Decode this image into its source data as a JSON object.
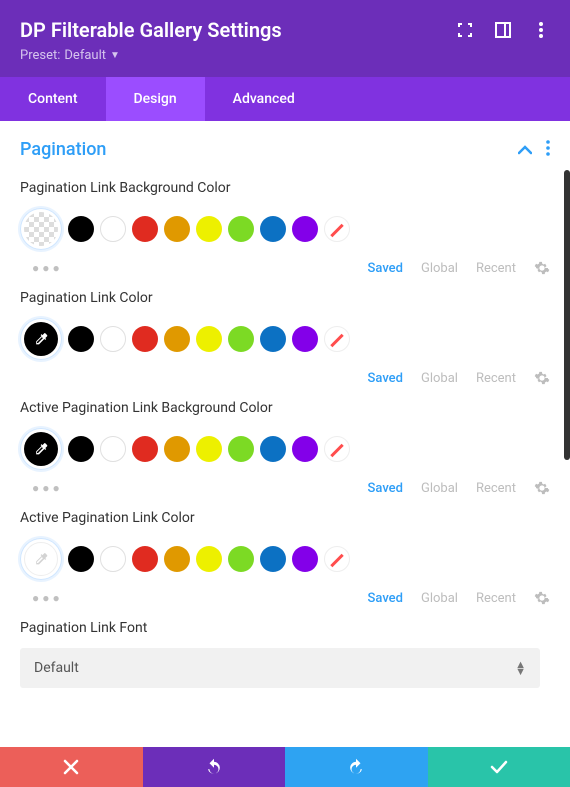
{
  "header": {
    "title": "DP Filterable Gallery Settings",
    "preset_label": "Preset:",
    "preset_value": "Default"
  },
  "tabs": {
    "content": "Content",
    "design": "Design",
    "advanced": "Advanced",
    "active": "design"
  },
  "section": {
    "title": "Pagination"
  },
  "footer_labels": {
    "saved": "Saved",
    "global": "Global",
    "recent": "Recent"
  },
  "fields": [
    {
      "label": "Pagination Link Background Color",
      "current": "transparent"
    },
    {
      "label": "Pagination Link Color",
      "current": "black"
    },
    {
      "label": "Active Pagination Link Background Color",
      "current": "black"
    },
    {
      "label": "Active Pagination Link Color",
      "current": "white"
    }
  ],
  "font_field": {
    "label": "Pagination Link Font",
    "value": "Default"
  },
  "palette": [
    "black",
    "white",
    "red",
    "orange",
    "yellow",
    "green",
    "blue",
    "purple",
    "clear"
  ]
}
